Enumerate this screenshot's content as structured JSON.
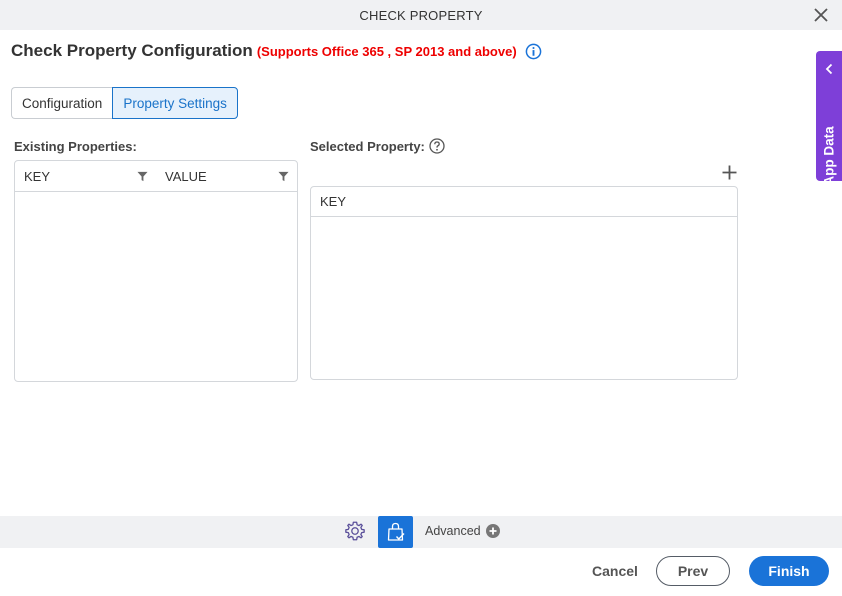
{
  "window": {
    "title": "CHECK PROPERTY",
    "close_icon": "close-icon"
  },
  "header": {
    "title": "Check Property Configuration",
    "subtitle": "(Supports Office 365 , SP 2013 and above)",
    "info_icon": "info-icon"
  },
  "tabs": [
    {
      "label": "Configuration",
      "active": false
    },
    {
      "label": "Property Settings",
      "active": true
    }
  ],
  "existing_properties": {
    "label": "Existing Properties:",
    "columns": [
      "KEY",
      "VALUE"
    ],
    "rows": []
  },
  "selected_property": {
    "label": "Selected Property:",
    "help_icon": "help-icon",
    "add_icon": "plus-icon",
    "columns": [
      "KEY"
    ],
    "rows": []
  },
  "side_panel": {
    "label": "App Data"
  },
  "toolbar": {
    "advanced_label": "Advanced"
  },
  "footer": {
    "cancel": "Cancel",
    "prev": "Prev",
    "finish": "Finish"
  },
  "colors": {
    "primary": "#1a73d8",
    "side_panel": "#7e3fd8",
    "warning_text": "#e00000"
  }
}
